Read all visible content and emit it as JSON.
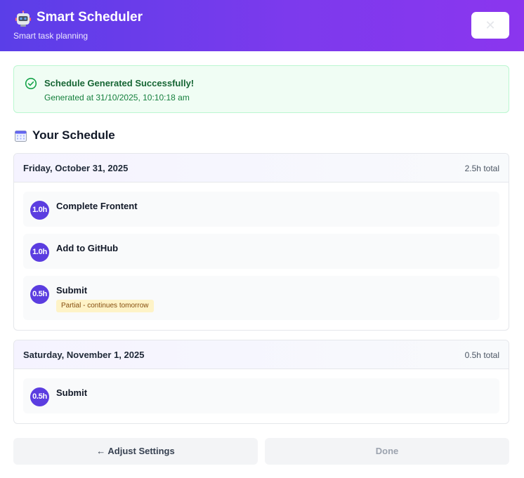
{
  "header": {
    "title": "Smart Scheduler",
    "subtitle": "Smart task planning",
    "close_label": "✕",
    "gradient_start": "#5a3ee8",
    "gradient_end": "#8b36ee"
  },
  "status": {
    "icon": "check-circle-icon",
    "title": "Schedule Generated Successfully!",
    "generated_at": "Generated at 31/10/2025, 10:10:18 am",
    "color": "#166534"
  },
  "schedule": {
    "heading": "Your Schedule",
    "icon": "calendar-icon",
    "days": [
      {
        "date": "Friday, October 31, 2025",
        "total": "2.5h total",
        "tasks": [
          {
            "hours": "1.0h",
            "name": "Complete Frontent",
            "badge": ""
          },
          {
            "hours": "1.0h",
            "name": "Add to GitHub",
            "badge": ""
          },
          {
            "hours": "0.5h",
            "name": "Submit",
            "badge": "Partial - continues tomorrow"
          }
        ]
      },
      {
        "date": "Saturday, November 1, 2025",
        "total": "0.5h total",
        "tasks": [
          {
            "hours": "0.5h",
            "name": "Submit",
            "badge": ""
          }
        ]
      }
    ]
  },
  "actions": {
    "adjust_label": "← Adjust Settings",
    "done_label": "Done"
  }
}
